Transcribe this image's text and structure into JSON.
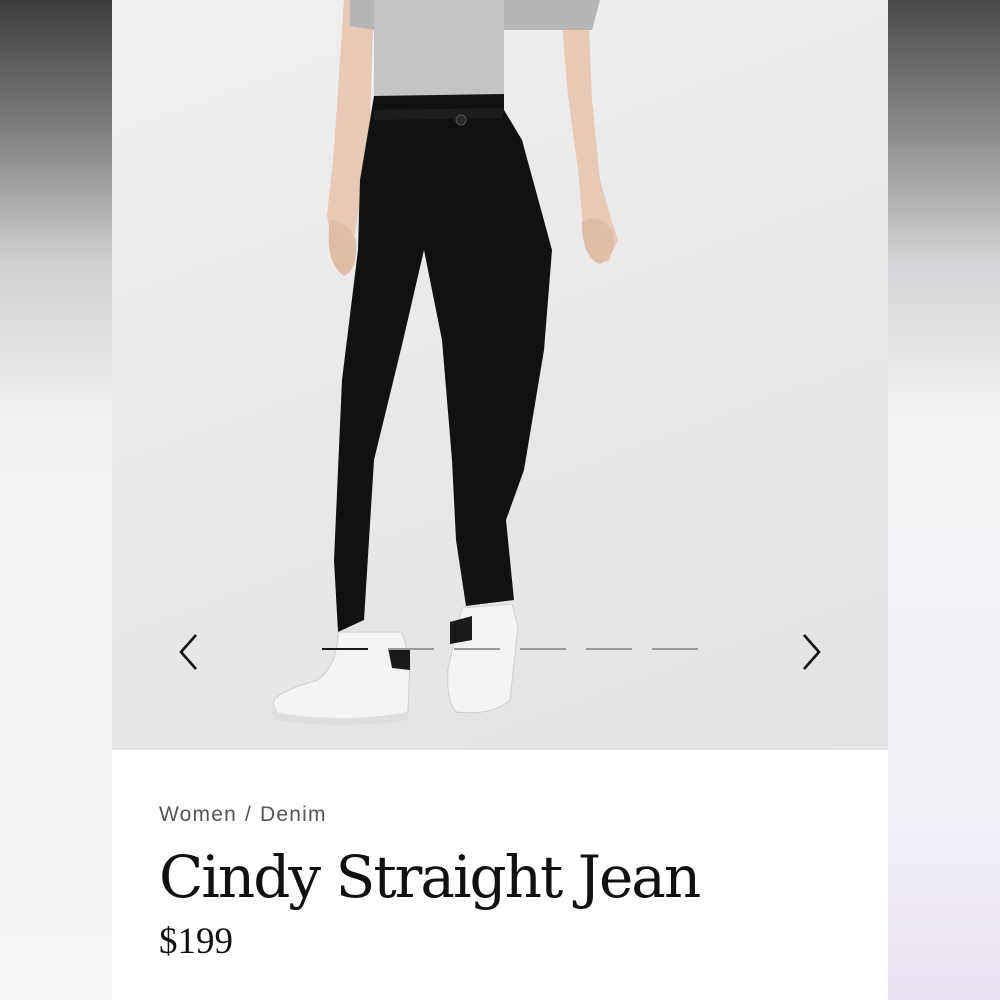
{
  "carousel": {
    "prev_icon": "chevron-left-icon",
    "next_icon": "chevron-right-icon",
    "slide_count": 6,
    "active_slide": 1
  },
  "breadcrumb": {
    "items": [
      "Women",
      "Denim"
    ],
    "separator": "/"
  },
  "product": {
    "title": "Cindy Straight Jean",
    "price": "$199"
  }
}
